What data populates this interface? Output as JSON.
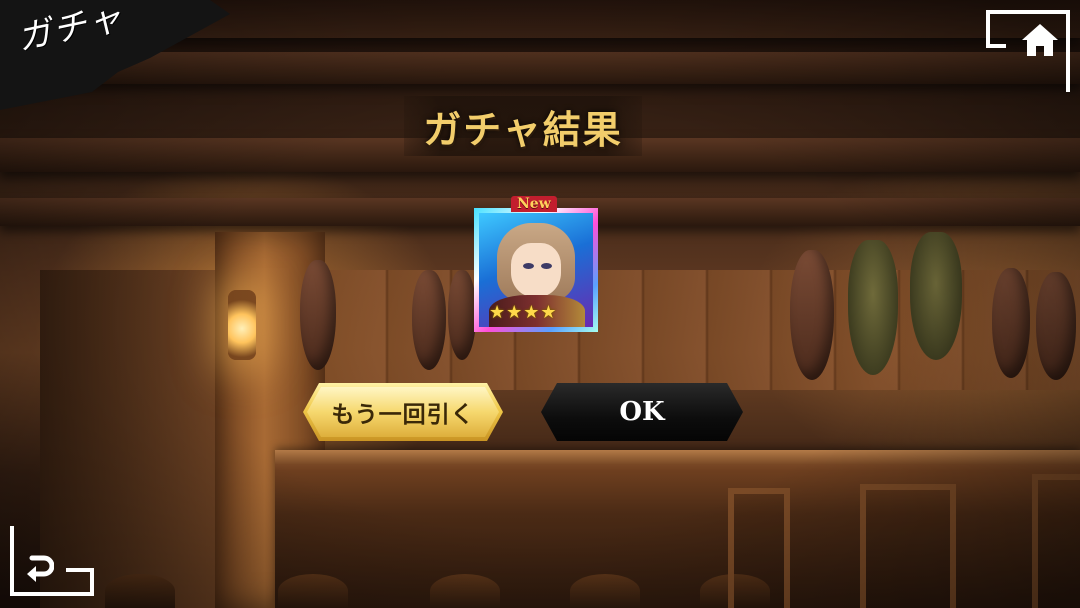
{
  "screen": {
    "corner_title": "ガチャ",
    "result_title": "ガチャ結果"
  },
  "result_card": {
    "new_badge": "New",
    "stars_display": "★★★★",
    "rarity_stars": 4
  },
  "buttons": {
    "retry_label": "もう一回引く",
    "ok_label": "OK"
  },
  "icons": {
    "home": "home-icon",
    "back": "back-arrow-icon"
  },
  "colors": {
    "title_gold": "#f2cd6b",
    "retry_button": "#f0c94a",
    "ok_button": "#0d0d0d"
  }
}
